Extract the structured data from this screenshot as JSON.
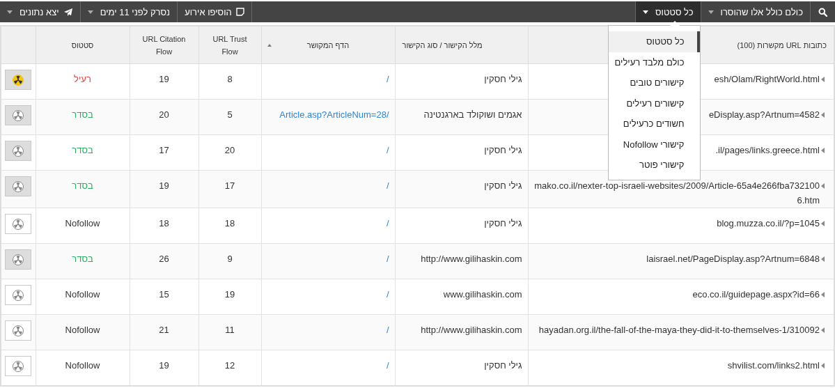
{
  "toolbar": {
    "filters": [
      {
        "label": "כולם כולל אלו שהוסרו",
        "open": false
      },
      {
        "label": "כל סטטוס",
        "open": true
      }
    ],
    "status_menu": [
      {
        "label": "כל סטטוס",
        "selected": true
      },
      {
        "label": "כולם מלבד רעילים",
        "selected": false
      },
      {
        "label": "קישורים טובים",
        "selected": false
      },
      {
        "label": "קישורים רעילים",
        "selected": false
      },
      {
        "label": "חשודים כרעילים",
        "selected": false
      },
      {
        "label": "קישורי Nofollow",
        "selected": false
      },
      {
        "label": "קישורי פוטר",
        "selected": false
      }
    ],
    "actions": [
      {
        "label": "הוסיפו אירוע",
        "kind": "note"
      },
      {
        "label": "נסרק לפני 11 ימים",
        "kind": "dropdown"
      },
      {
        "label": "יצא נתונים",
        "kind": "export"
      }
    ]
  },
  "table": {
    "columns": [
      {
        "label": "כתובות URL מקשרות (100)",
        "sorted": false
      },
      {
        "label": "מלל הקישור / סוג הקישור",
        "sorted": false
      },
      {
        "label": "הדף המקושר",
        "sorted": true
      },
      {
        "label": "URL Trust Flow",
        "sorted": false
      },
      {
        "label": "URL Citation Flow",
        "sorted": false
      },
      {
        "label": "סטטוס",
        "sorted": false
      }
    ],
    "rows": [
      {
        "url": "esh/Olam/RightWorld.html",
        "anchor": "גילי חסקין",
        "target": "/",
        "trust_flow": "8",
        "citation_flow": "19",
        "status": "רעיל",
        "kind": "toxic"
      },
      {
        "url": "eDisplay.asp?Artnum=4582",
        "anchor": "אגמים ושוקולד בארגנטינה",
        "target": "Article.asp?ArticleNum=28/",
        "trust_flow": "5",
        "citation_flow": "20",
        "status": "בסדר",
        "kind": "ok"
      },
      {
        "url": ".il/pages/links.greece.html",
        "anchor": "גילי חסקין",
        "target": "/",
        "trust_flow": "20",
        "citation_flow": "17",
        "status": "בסדר",
        "kind": "ok"
      },
      {
        "url": "mako.co.il/nexter-top-israeli-websites/2009/Article-65a4e266fba7321006.htm",
        "anchor": "גילי חסקין",
        "target": "/",
        "trust_flow": "17",
        "citation_flow": "19",
        "status": "בסדר",
        "kind": "ok"
      },
      {
        "url": "blog.muzza.co.il/?p=1045",
        "anchor": "גילי חסקין",
        "target": "/",
        "trust_flow": "18",
        "citation_flow": "18",
        "status": "Nofollow",
        "kind": "nofollow"
      },
      {
        "url": "laisrael.net/PageDisplay.asp?Artnum=6848",
        "anchor": "http://www.gilihaskin.com",
        "target": "/",
        "trust_flow": "9",
        "citation_flow": "26",
        "status": "בסדר",
        "kind": "ok"
      },
      {
        "url": "eco.co.il/guidepage.aspx?id=66",
        "anchor": "www.gilihaskin.com",
        "target": "/",
        "trust_flow": "19",
        "citation_flow": "15",
        "status": "Nofollow",
        "kind": "nofollow"
      },
      {
        "url": "hayadan.org.il/the-fall-of-the-maya-they-did-it-to-themselves-1/310092",
        "anchor": "http://www.gilihaskin.com",
        "target": "/",
        "trust_flow": "11",
        "citation_flow": "21",
        "status": "Nofollow",
        "kind": "nofollow"
      },
      {
        "url": "shvilist.com/links2.html",
        "anchor": "גילי חסקין",
        "target": "/",
        "trust_flow": "12",
        "citation_flow": "19",
        "status": "Nofollow",
        "kind": "nofollow"
      }
    ]
  }
}
